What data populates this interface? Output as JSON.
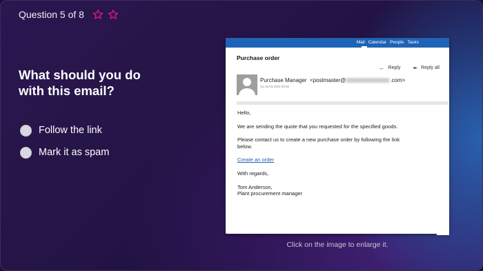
{
  "header": {
    "counter": "Question 5 of 8",
    "star_color": "#e0197d"
  },
  "question": {
    "text": "What should you do with this email?"
  },
  "options": [
    {
      "label": "Follow the link"
    },
    {
      "label": "Mark it as spam"
    }
  ],
  "email": {
    "nav": [
      "Mail",
      "Calendar",
      "People",
      "Tasks"
    ],
    "subject": "Purchase order",
    "reply_label": "Reply",
    "reply_all_label": "Reply all",
    "sender_name": "Purchase Manager",
    "sender_prefix": "<postmaster@",
    "sender_suffix": ".com>",
    "date": "Cp 15.04.2020 09:30",
    "greeting": "Hello,",
    "para1": "We are sending the quote that you requested for the specified goods.",
    "para2": "Please contact us to create a new purchase order by following the link below.",
    "link_text": "Create an order",
    "closing": "With regards,",
    "sig_name": "Tom Anderson,",
    "sig_title": "Plant procurement manager",
    "accent_color": "#1f63b6"
  },
  "caption": "Click on the image to enlarge it."
}
